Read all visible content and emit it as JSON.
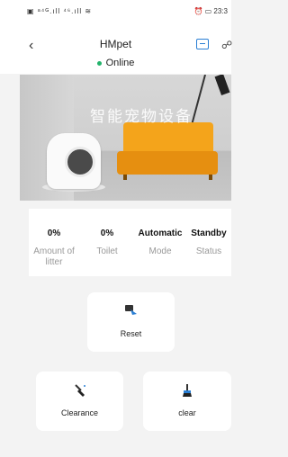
{
  "status_bar": {
    "left": "▣ ᵃ⁴ᴳ.ıll ⁴⁶.ıll ≋",
    "right": "⏰ ▭ 23:3"
  },
  "header": {
    "title": "HMpet",
    "status": "Online",
    "back_icon": "chevron-left-icon",
    "chat_icon": "message-icon",
    "more_icon": "settings-icon"
  },
  "hero": {
    "text": "智能宠物设备"
  },
  "info": {
    "cells": [
      {
        "value": "0%",
        "label": "Amount of litter"
      },
      {
        "value": "0%",
        "label": "Toilet"
      },
      {
        "value": "Automatic",
        "label": "Mode"
      },
      {
        "value": "Standby",
        "label": "Status"
      }
    ]
  },
  "actions": {
    "reset": "Reset",
    "clearance": "Clearance",
    "clear": "clear"
  },
  "colors": {
    "accent": "#2a7fd4",
    "online": "#23b36b",
    "sofa": "#f4a41b"
  }
}
